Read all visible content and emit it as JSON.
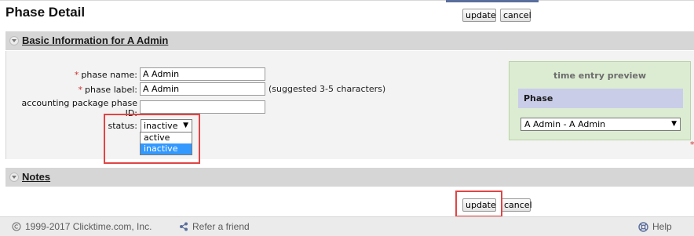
{
  "page": {
    "title": "Phase Detail"
  },
  "toolbar": {
    "update_label": "update",
    "cancel_label": "cancel"
  },
  "sections": {
    "basic": {
      "heading": "Basic Information for A Admin"
    },
    "notes": {
      "heading": "Notes"
    }
  },
  "form": {
    "required_marker": "*",
    "phase_name": {
      "label": "phase name:",
      "value": "A Admin"
    },
    "phase_label": {
      "label": "phase label:",
      "value": "A Admin",
      "hint": "(suggested 3-5 characters)"
    },
    "accounting_id": {
      "label": "accounting package phase ID:",
      "value": ""
    },
    "status": {
      "label": "status:",
      "selected": "inactive",
      "options": [
        "active",
        "inactive"
      ],
      "highlighted_option": "inactive"
    }
  },
  "preview": {
    "title": "time entry preview",
    "header": "Phase",
    "select_value": "A Admin - A Admin"
  },
  "footer": {
    "copyright": "1999-2017 Clicktime.com, Inc.",
    "refer_label": "Refer a friend",
    "help_label": "Help"
  },
  "icons": {
    "caret": "▼"
  },
  "colors": {
    "highlight_box": "#e04545",
    "section_bar": "#d6d6d6",
    "preview_panel": "#dcecd2",
    "selected_option": "#3399ff"
  }
}
